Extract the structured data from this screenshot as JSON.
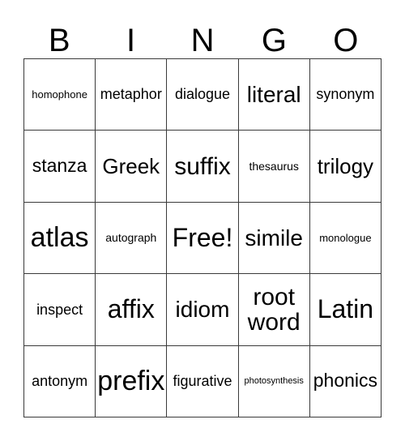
{
  "card": {
    "title": "BINGO",
    "header_letters": [
      "B",
      "I",
      "N",
      "G",
      "O"
    ],
    "free_space_label": "Free!",
    "grid_size": "5x5",
    "colors": {
      "border": "#3a3a3a",
      "text": "#000000",
      "background": "#ffffff"
    },
    "rows": [
      [
        {
          "label": "homophone",
          "size": "fs-sm"
        },
        {
          "label": "metaphor",
          "size": "fs-md2"
        },
        {
          "label": "dialogue",
          "size": "fs-md2"
        },
        {
          "label": "literal",
          "size": "fs-xl2"
        },
        {
          "label": "synonym",
          "size": "fs-md2"
        }
      ],
      [
        {
          "label": "stanza",
          "size": "fs-lg2"
        },
        {
          "label": "Greek",
          "size": "fs-xl"
        },
        {
          "label": "suffix",
          "size": "fs-xxl"
        },
        {
          "label": "thesaurus",
          "size": "fs-sm2"
        },
        {
          "label": "trilogy",
          "size": "fs-xl"
        }
      ],
      [
        {
          "label": "atlas",
          "size": "fs-huge"
        },
        {
          "label": "autograph",
          "size": "fs-sm2"
        },
        {
          "label": "Free!",
          "size": "fs-xxl2"
        },
        {
          "label": "simile",
          "size": "fs-xl2"
        },
        {
          "label": "monologue",
          "size": "fs-sm"
        }
      ],
      [
        {
          "label": "inspect",
          "size": "fs-md2"
        },
        {
          "label": "affix",
          "size": "fs-xxl2"
        },
        {
          "label": "idiom",
          "size": "fs-xl2"
        },
        {
          "label": "root word",
          "size": "fs-xxl"
        },
        {
          "label": "Latin",
          "size": "fs-xxl2"
        }
      ],
      [
        {
          "label": "antonym",
          "size": "fs-md2"
        },
        {
          "label": "prefix",
          "size": "fs-huge"
        },
        {
          "label": "figurative",
          "size": "fs-md2"
        },
        {
          "label": "photosynthesis",
          "size": "fs-xs"
        },
        {
          "label": "phonics",
          "size": "fs-lg2"
        }
      ]
    ]
  }
}
